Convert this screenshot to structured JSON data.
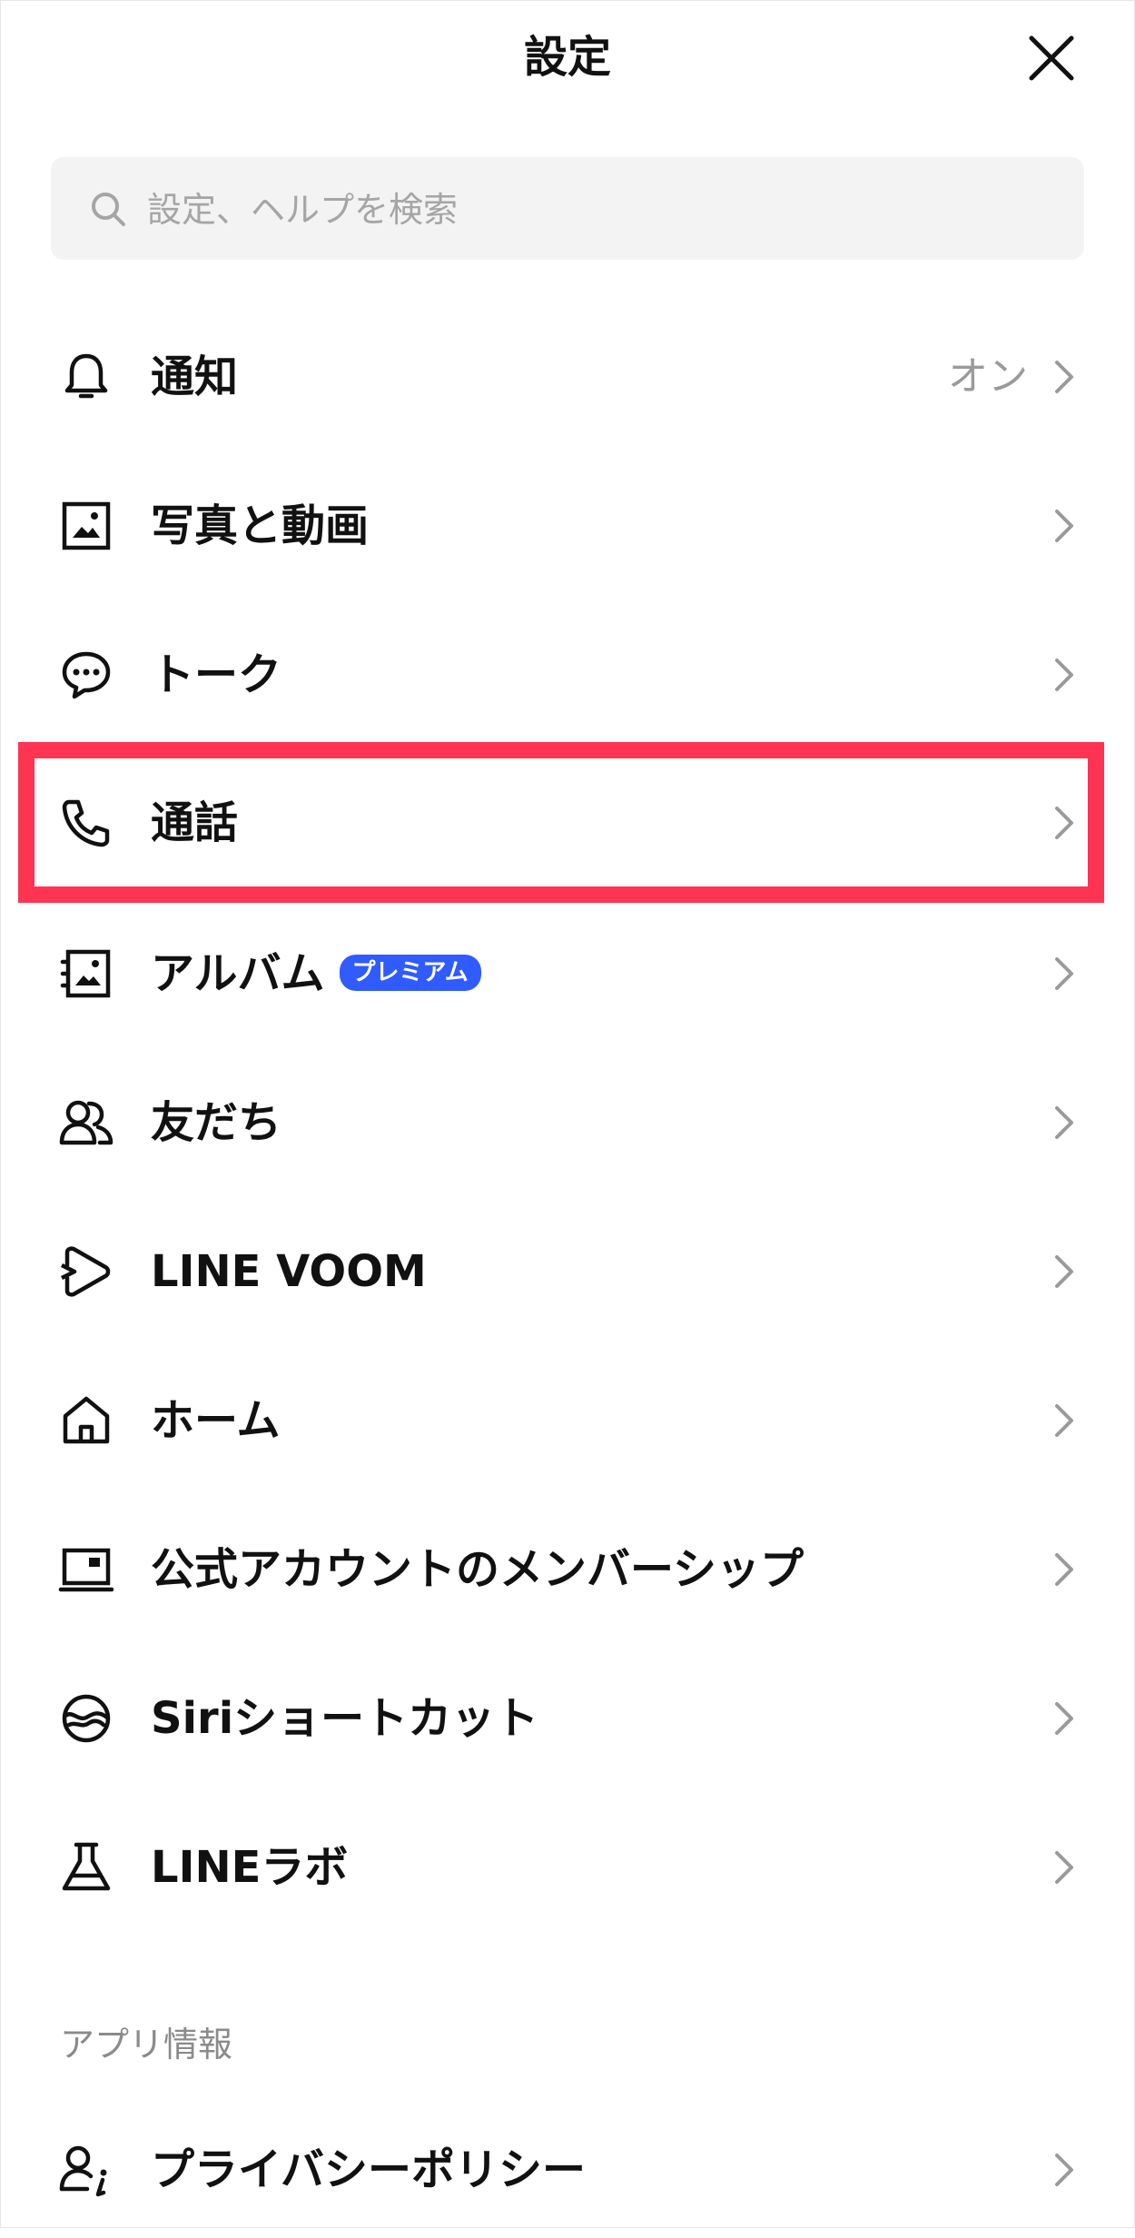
{
  "header": {
    "title": "設定"
  },
  "search": {
    "placeholder": "設定、ヘルプを検索"
  },
  "items": [
    {
      "label": "通知",
      "value": "オン",
      "icon": "bell-icon"
    },
    {
      "label": "写真と動画",
      "icon": "photo-icon"
    },
    {
      "label": "トーク",
      "icon": "chat-bubble-icon"
    },
    {
      "label": "通話",
      "icon": "phone-icon"
    },
    {
      "label": "アルバム",
      "badge": "プレミアム",
      "icon": "album-icon"
    },
    {
      "label": "友だち",
      "icon": "friends-icon"
    },
    {
      "label": "LINE VOOM",
      "icon": "voom-icon"
    },
    {
      "label": "ホーム",
      "icon": "home-icon"
    },
    {
      "label": "公式アカウントのメンバーシップ",
      "icon": "membership-icon"
    },
    {
      "label": "Siriショートカット",
      "icon": "siri-icon"
    },
    {
      "label": "LINEラボ",
      "icon": "flask-icon"
    }
  ],
  "sections": {
    "app_info": {
      "title": "アプリ情報",
      "items": [
        {
          "label": "プライバシーポリシー",
          "icon": "privacy-icon"
        }
      ]
    }
  },
  "colors": {
    "highlight": "#ff3352",
    "badge": "#2f5bff",
    "chevron": "#9a9a9a"
  }
}
